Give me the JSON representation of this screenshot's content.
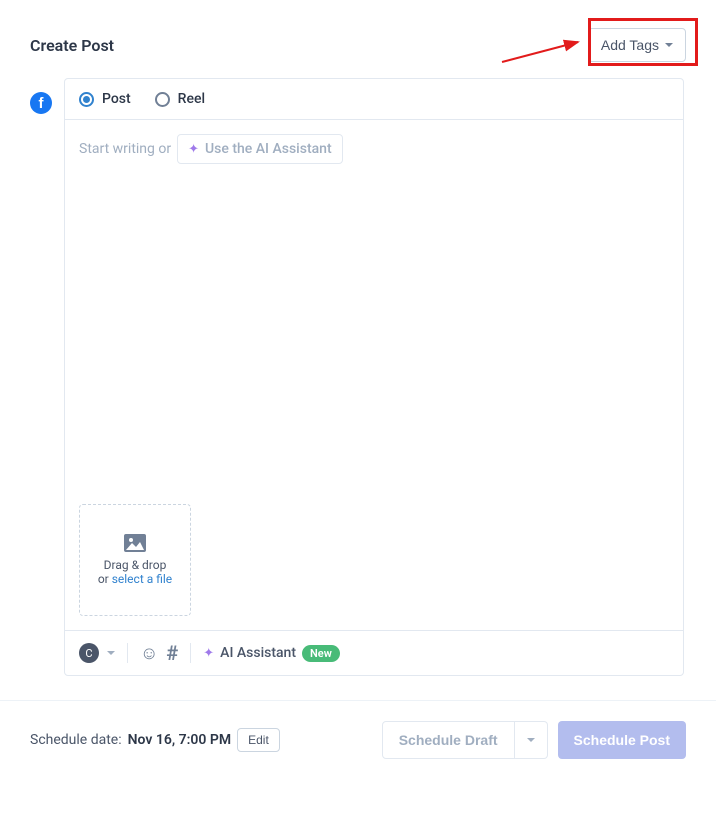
{
  "header": {
    "title": "Create Post",
    "add_tags_label": "Add Tags"
  },
  "platform": {
    "name": "facebook",
    "letter": "f"
  },
  "post_types": {
    "selected": "post",
    "post_label": "Post",
    "reel_label": "Reel"
  },
  "editor": {
    "placeholder_prefix": "Start writing or",
    "ai_chip_label": "Use the AI Assistant"
  },
  "dropzone": {
    "line1": "Drag & drop",
    "line2_prefix": "or ",
    "link_text": "select a file"
  },
  "toolbar": {
    "counter_label": "C",
    "ai_label": "AI Assistant",
    "new_badge": "New"
  },
  "footer": {
    "schedule_prefix": "Schedule date:",
    "schedule_value": "Nov 16, 7:00 PM",
    "edit_label": "Edit",
    "draft_label": "Schedule Draft",
    "schedule_button": "Schedule Post"
  }
}
